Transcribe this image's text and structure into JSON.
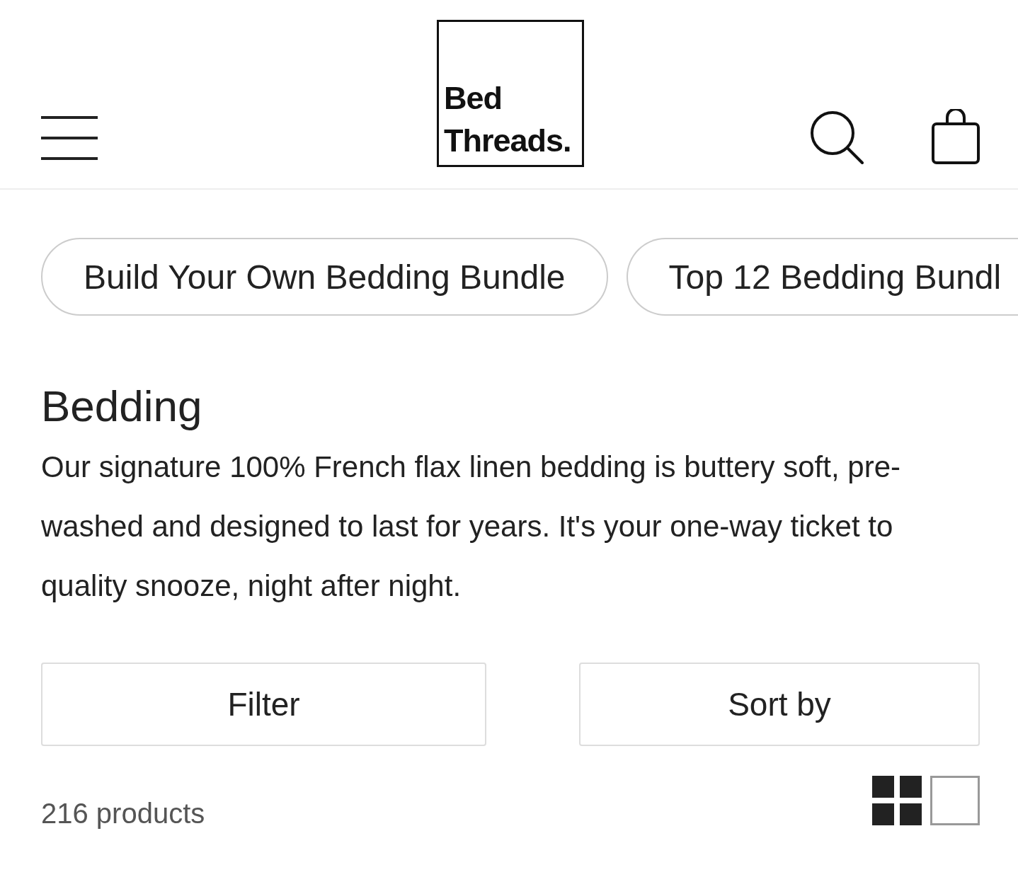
{
  "header": {
    "logo": {
      "lines": [
        "Bed",
        "Threads."
      ]
    }
  },
  "chips": [
    {
      "label": "Build Your Own Bedding Bundle"
    },
    {
      "label": "Top 12 Bedding Bundl"
    }
  ],
  "collection": {
    "title": "Bedding",
    "description": "Our signature 100% French flax linen bedding is buttery soft, pre-washed and designed to last for years. It's your one-way ticket to quality snooze, night after night."
  },
  "controls": [
    {
      "kind": "filter",
      "label": "Filter"
    },
    {
      "kind": "sort",
      "label": "Sort by"
    }
  ],
  "product_count": "216 products",
  "view_toggle": [
    {
      "kind": "grid",
      "selected": true
    },
    {
      "kind": "single",
      "selected": false
    }
  ]
}
